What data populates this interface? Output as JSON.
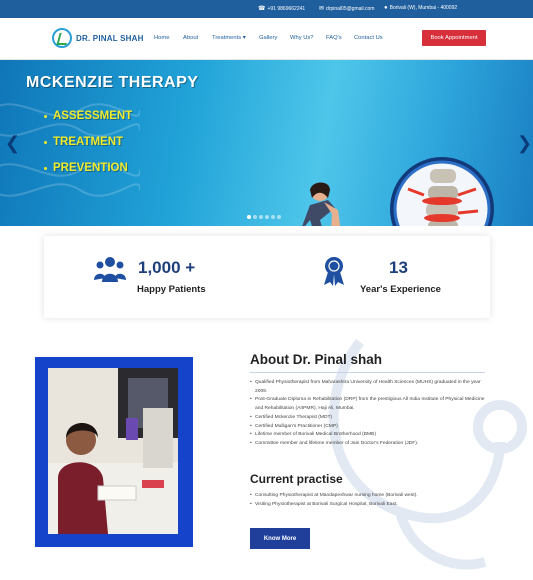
{
  "topbar": {
    "phone": "+91 9869662241",
    "email": "drpinal05@gmail.com",
    "location": "Borivali (W), Mumbai - 400092"
  },
  "header": {
    "logo_text": "DR. PINAL SHAH",
    "nav": [
      "Home",
      "About",
      "Treatments",
      "Gallery",
      "Why Us?",
      "FAQ's",
      "Contact Us"
    ],
    "cta": "Book Appointment"
  },
  "hero": {
    "title": "MCKENZIE THERAPY",
    "bullets": [
      "ASSESSMENT",
      "TREATMENT",
      "PREVENTION"
    ],
    "slide_count": 6,
    "active_slide": 0
  },
  "stats": [
    {
      "icon": "people-group-icon",
      "value": "1,000 +",
      "label": "Happy Patients"
    },
    {
      "icon": "award-ribbon-icon",
      "value": "13",
      "label": "Year's Experience"
    }
  ],
  "about": {
    "title": "About Dr. Pinal shah",
    "items": [
      "Qualified Physiotherapist from Maharashtra University of Health Sciences (MUHS) graduated in the year 2009.",
      "Post-Graduate Diploma in Rehabilitation (DRP) from the prestigious All India Institute of Physical Medicine and Rehabilitation (AIIPMR), Haji Ali, Mumbai.",
      "Certified Mckenzie Therapist (MDT)",
      "Certified Mulligan's Practitioner (CMP)",
      "Lifetime member of Borivali Medical Brotherhood (BMB)",
      "Committee member and lifetime member of Jain Doctor's Federation (JDF)."
    ],
    "current_title": "Current practise",
    "current_items": [
      "Consulting Physiotherapist at Mandapeshwar nursing home (Borivali west).",
      "Visiting Physiotherapist at Borivali Surgical Hospital, Borivali East."
    ],
    "button": "Know More"
  },
  "colors": {
    "topbar": "#1f5f9e",
    "cta": "#d7303b",
    "accent_navy": "#1f3f7a",
    "photo_frame": "#1543c9",
    "bullet_yellow": "#f2ea2a"
  }
}
